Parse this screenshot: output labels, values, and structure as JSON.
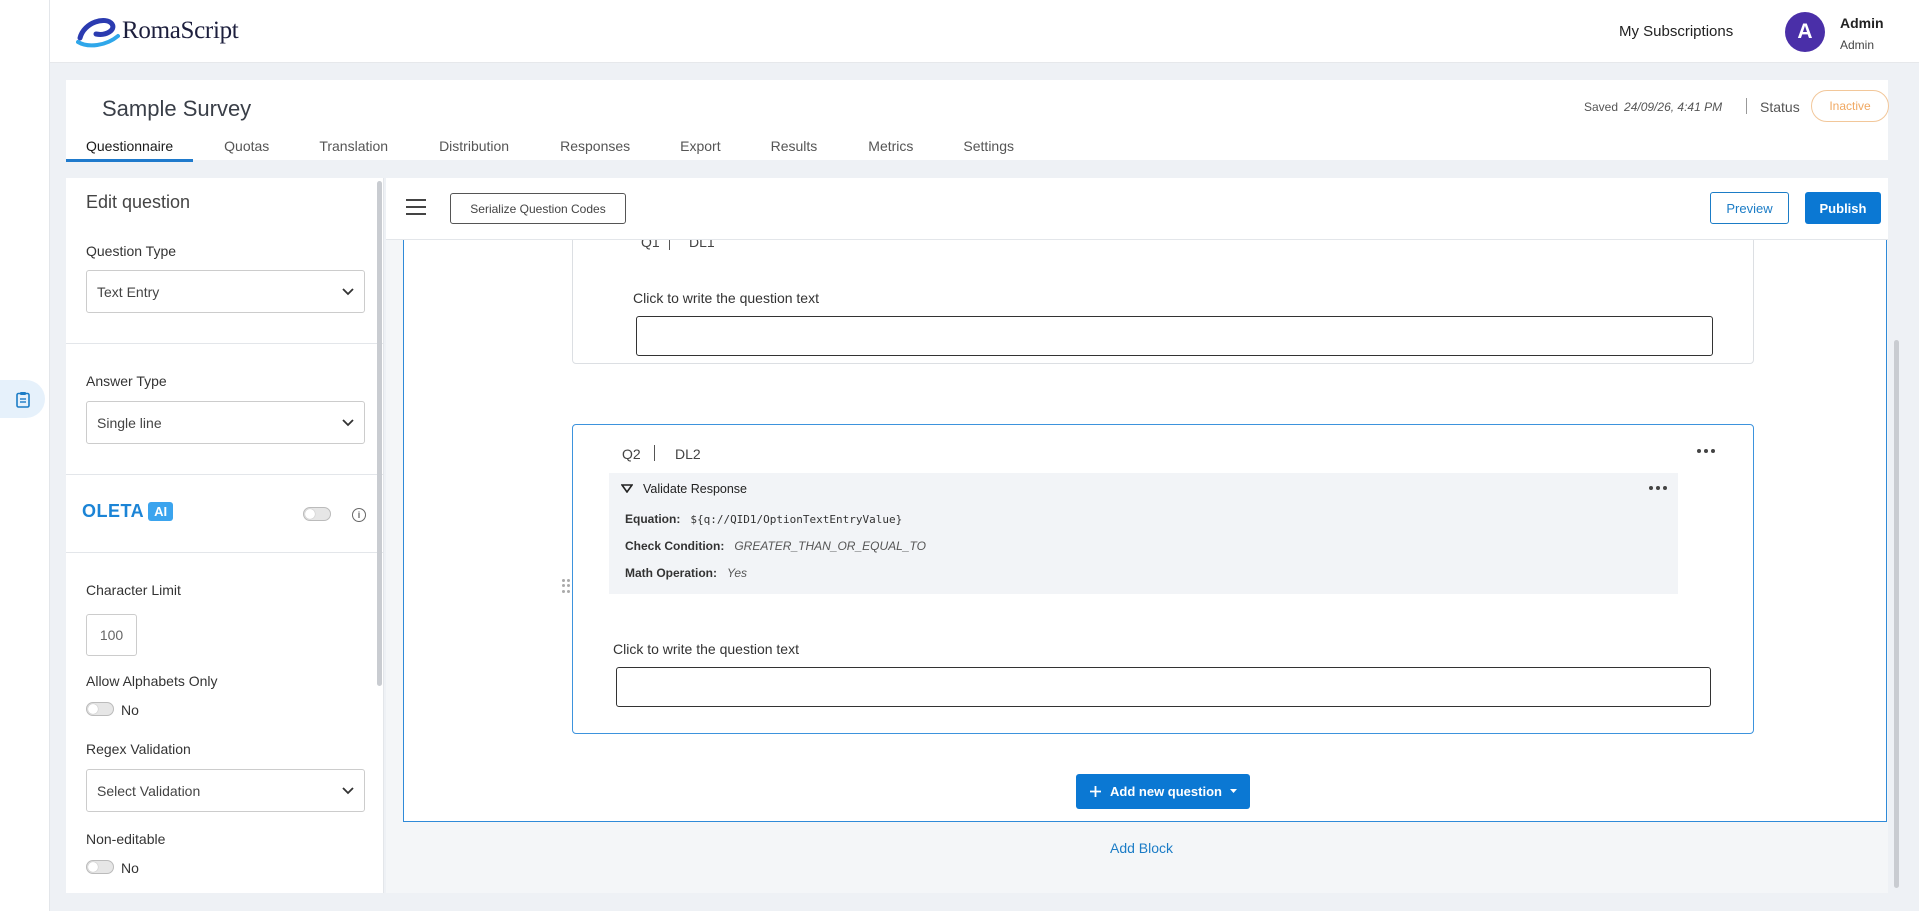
{
  "app": {
    "logo_text": "RomaScript"
  },
  "header": {
    "subscriptions_label": "My Subscriptions",
    "user": {
      "initial": "A",
      "name": "Admin",
      "role": "Admin"
    }
  },
  "survey": {
    "title": "Sample Survey",
    "saved_label": "Saved",
    "saved_time": "24/09/26, 4:41 PM",
    "status_label": "Status",
    "status_value": "Inactive",
    "tabs": [
      {
        "label": "Questionnaire",
        "active": true
      },
      {
        "label": "Quotas"
      },
      {
        "label": "Translation"
      },
      {
        "label": "Distribution"
      },
      {
        "label": "Responses"
      },
      {
        "label": "Export"
      },
      {
        "label": "Results"
      },
      {
        "label": "Metrics"
      },
      {
        "label": "Settings"
      }
    ]
  },
  "edit_panel": {
    "title": "Edit question",
    "question_type_label": "Question Type",
    "question_type_value": "Text Entry",
    "answer_type_label": "Answer Type",
    "answer_type_value": "Single line",
    "oleta_text": "OLETA",
    "ai_badge": "AI",
    "character_limit_label": "Character Limit",
    "character_limit_value": "100",
    "allow_alphabets_label": "Allow Alphabets Only",
    "allow_alphabets_value": "No",
    "regex_label": "Regex Validation",
    "regex_value": "Select Validation",
    "non_editable_label": "Non-editable",
    "non_editable_value": "No"
  },
  "toolbar": {
    "serialize_label": "Serialize Question Codes",
    "preview_label": "Preview",
    "publish_label": "Publish"
  },
  "questions": [
    {
      "code": "Q1",
      "block": "DL1",
      "text": "Click to write the question text"
    },
    {
      "code": "Q2",
      "block": "DL2",
      "text": "Click to write the question text",
      "validation": {
        "title": "Validate Response",
        "equation_label": "Equation:",
        "equation_value": "${q://QID1/OptionTextEntryValue}",
        "check_label": "Check Condition:",
        "check_value": "GREATER_THAN_OR_EQUAL_TO",
        "math_label": "Math Operation:",
        "math_value": "Yes"
      }
    }
  ],
  "actions": {
    "add_question_label": "Add new question",
    "add_block_label": "Add Block"
  },
  "colors": {
    "primary": "#0b78d3",
    "avatar": "#4a2fa8",
    "status_inactive": "#f0a862",
    "oleta": "#1b84d6"
  }
}
